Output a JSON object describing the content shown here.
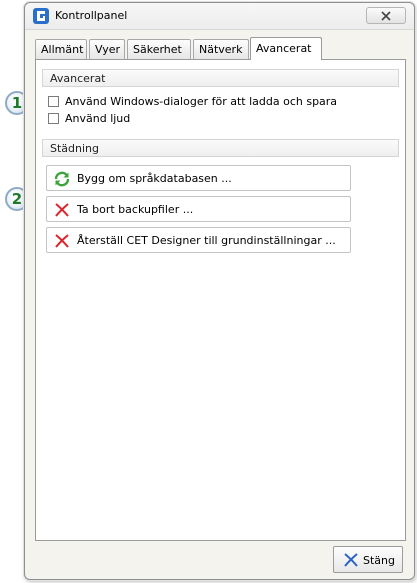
{
  "window": {
    "title": "Kontrollpanel",
    "icon": "control-panel-app-icon"
  },
  "tabs": [
    {
      "label": "Allmänt",
      "active": false
    },
    {
      "label": "Vyer",
      "active": false
    },
    {
      "label": "Säkerhet",
      "active": false
    },
    {
      "label": "Nätverk",
      "active": false
    },
    {
      "label": "Avancerat",
      "active": true
    }
  ],
  "advanced": {
    "header": "Avancerat",
    "options": [
      {
        "label": "Använd Windows-dialoger för att ladda och spara",
        "checked": false
      },
      {
        "label": "Använd ljud",
        "checked": false
      }
    ]
  },
  "cleanup": {
    "header": "Städning",
    "buttons": [
      {
        "label": "Bygg om språkdatabasen ...",
        "icon": "refresh-icon"
      },
      {
        "label": "Ta bort backupfiler ...",
        "icon": "delete-x-icon"
      },
      {
        "label": "Återställ CET Designer till grundinställningar ...",
        "icon": "delete-x-icon"
      }
    ]
  },
  "footer": {
    "close_label": "Stäng"
  },
  "callouts": [
    "1",
    "2"
  ],
  "colors": {
    "callout_text": "#1e7a2a",
    "delete_icon": "#d9252a",
    "refresh_icon": "#3aa33a",
    "close_icon": "#2b63c6"
  }
}
